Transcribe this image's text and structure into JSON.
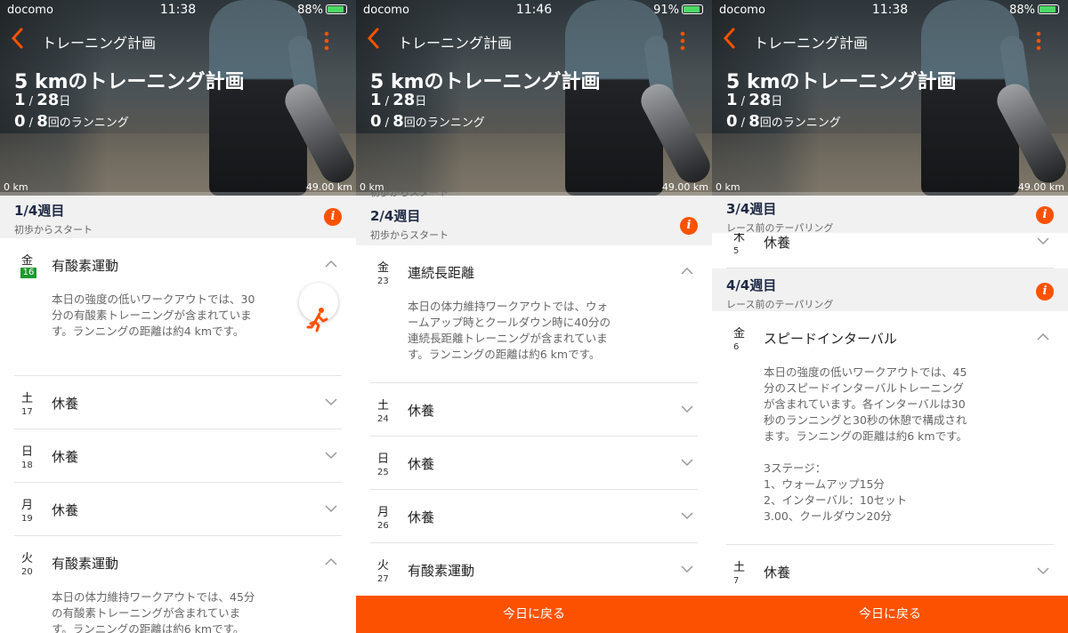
{
  "panels": [
    {
      "status": {
        "carrier": "docomo",
        "time": "11:38",
        "battery": "88%",
        "battery_level": 0.88
      },
      "nav": {
        "title": "トレーニング計画"
      },
      "hero": {
        "title": "5 kmのトレーニング計画",
        "day_current": "1",
        "day_sep": " / ",
        "day_total": "28",
        "day_unit": "日",
        "run_current": "0",
        "run_sep": " / ",
        "run_total": "8",
        "run_unit": "回のランニング",
        "km_start": "0 km",
        "km_end": "49.00 km",
        "progress": 0.0
      },
      "week1": {
        "title": "1/4週目",
        "subtitle": "初歩からスタート"
      },
      "days": [
        {
          "dow": "金",
          "date": "16",
          "name": "有酸素運動",
          "desc": "本日の強度の低いワークアウトでは、30\n分の有酸素トレーニングが含まれていま\nす。ランニングの距離は約4 kmです。"
        },
        {
          "dow": "土",
          "date": "17",
          "name": "休養"
        },
        {
          "dow": "日",
          "date": "18",
          "name": "休養"
        },
        {
          "dow": "月",
          "date": "19",
          "name": "休養"
        },
        {
          "dow": "火",
          "date": "20",
          "name": "有酸素運動",
          "desc": "本日の体力維持ワークアウトでは、45分\nの有酸素トレーニングが含まれていま\nす。ランニングの距離は約6 kmです。"
        }
      ]
    },
    {
      "status": {
        "carrier": "docomo",
        "time": "11:46",
        "battery": "91%",
        "battery_level": 0.91
      },
      "nav": {
        "title": "トレーニング計画"
      },
      "hero": {
        "title": "5 kmのトレーニング計画",
        "day_current": "1",
        "day_sep": " / ",
        "day_total": "28",
        "day_unit": "日",
        "run_current": "0",
        "run_sep": " / ",
        "run_total": "8",
        "run_unit": "回のランニング",
        "km_start": "0 km",
        "km_end": "49.00 km",
        "progress": 0.0
      },
      "peek": "初歩からスタート",
      "week": {
        "title": "2/4週目",
        "subtitle": "初歩からスタート"
      },
      "days": [
        {
          "dow": "金",
          "date": "23",
          "name": "連続長距離",
          "desc": "本日の体力維持ワークアウトでは、ウォ\nームアップ時とクールダウン時に40分の\n連続長距離トレーニングが含まれていま\nす。ランニングの距離は約6 kmです。"
        },
        {
          "dow": "土",
          "date": "24",
          "name": "休養"
        },
        {
          "dow": "日",
          "date": "25",
          "name": "休養"
        },
        {
          "dow": "月",
          "date": "26",
          "name": "休養"
        },
        {
          "dow": "火",
          "date": "27",
          "name": "有酸素運動"
        }
      ],
      "today_button": "今日に戻る"
    },
    {
      "status": {
        "carrier": "docomo",
        "time": "11:38",
        "battery": "88%",
        "battery_level": 0.88
      },
      "nav": {
        "title": "トレーニング計画"
      },
      "hero": {
        "title": "5 kmのトレーニング計画",
        "day_current": "1",
        "day_sep": " / ",
        "day_total": "28",
        "day_unit": "日",
        "run_current": "0",
        "run_sep": " / ",
        "run_total": "8",
        "run_unit": "回のランニング",
        "km_start": "0 km",
        "km_end": "49.00 km",
        "progress": 0.0
      },
      "week3": {
        "title": "3/4週目",
        "subtitle": "レース前のテーパリング"
      },
      "partial_day": {
        "dow": "木",
        "date": "5",
        "name": "休養"
      },
      "week4": {
        "title": "4/4週目",
        "subtitle": "レース前のテーパリング"
      },
      "days": [
        {
          "dow": "金",
          "date": "6",
          "name": "スピードインターバル",
          "desc": "本日の強度の低いワークアウトでは、45\n分のスピードインターバルトレーニング\nが含まれています。各インターバルは30\n秒のランニングと30秒の休憩で構成され\nます。ランニングの距離は約6 kmです。\n\n3ステージ：\n1、ウォームアップ15分\n2、インターバル：10セット\n3.00、クールダウン20分"
        },
        {
          "dow": "土",
          "date": "7",
          "name": "休養"
        }
      ],
      "today_button": "今日に戻る"
    }
  ],
  "colors": {
    "accent": "#fc5200",
    "today_badge": "#1d9a2e",
    "week_title": "#1f2a44"
  },
  "icons": {
    "back": "chevron-left-icon",
    "more": "more-vertical-icon",
    "info": "info-icon",
    "run": "running-person-icon",
    "expand": "chevron-down-icon",
    "collapse": "chevron-up-icon"
  }
}
